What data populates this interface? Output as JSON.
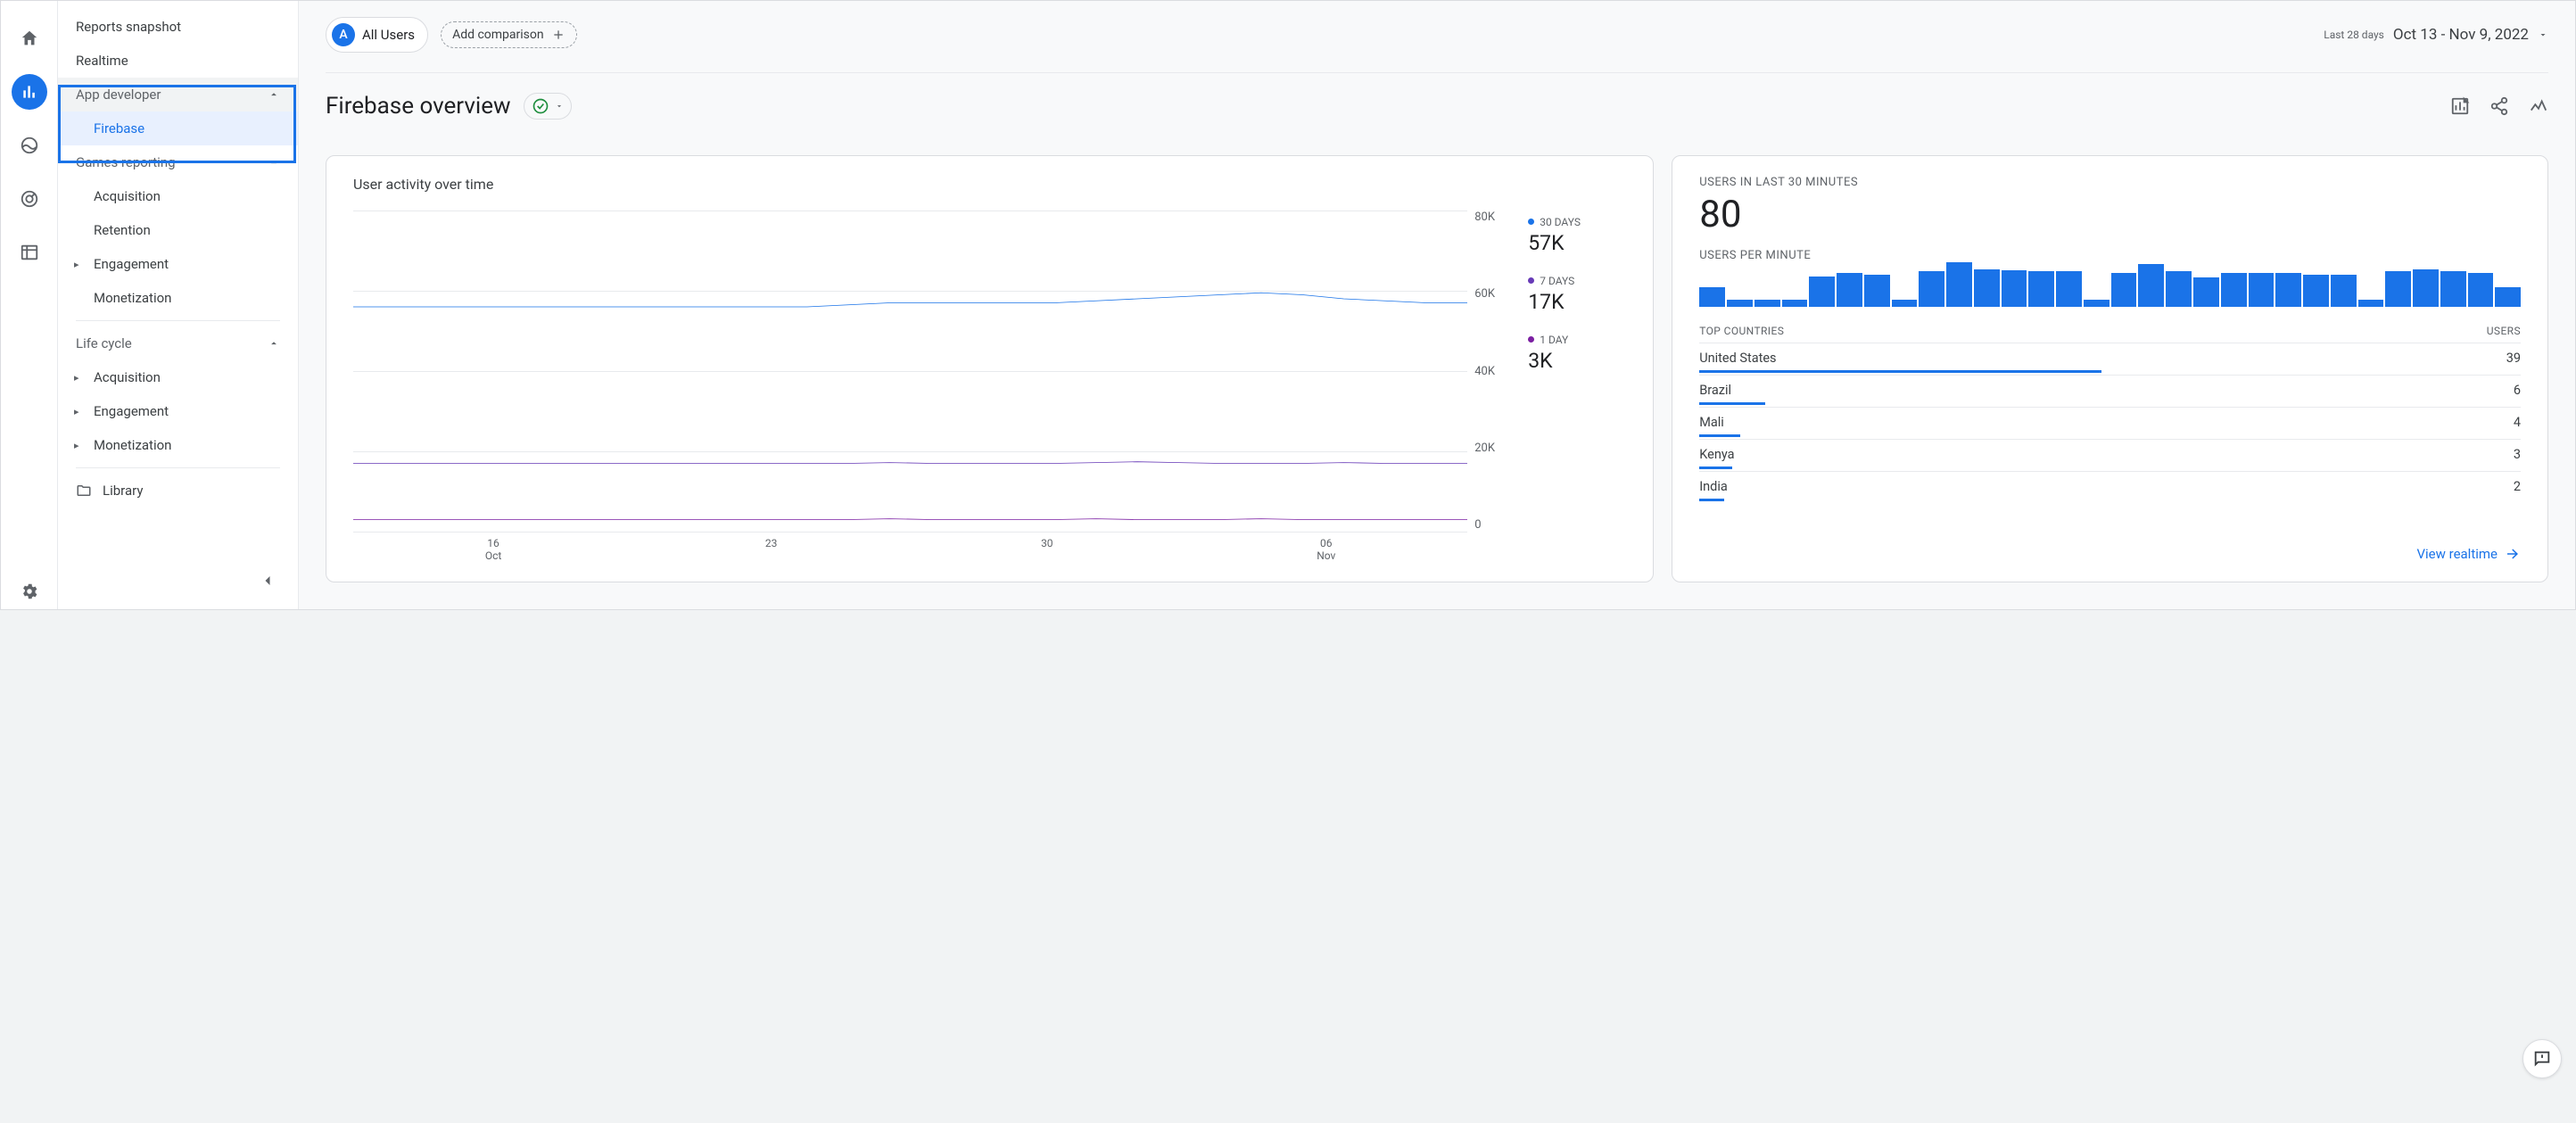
{
  "rail": {
    "active_index": 1
  },
  "sidebar": {
    "top": [
      {
        "label": "Reports snapshot"
      },
      {
        "label": "Realtime"
      }
    ],
    "groups": [
      {
        "label": "App developer",
        "items": [
          {
            "label": "Firebase",
            "selected": true
          }
        ],
        "highlighted_frame": true
      },
      {
        "label": "Games reporting",
        "items": [
          {
            "label": "Acquisition"
          },
          {
            "label": "Retention"
          },
          {
            "label": "Engagement",
            "has_children": true
          },
          {
            "label": "Monetization"
          }
        ]
      },
      {
        "label": "Life cycle",
        "items": [
          {
            "label": "Acquisition",
            "has_children": true
          },
          {
            "label": "Engagement",
            "has_children": true
          },
          {
            "label": "Monetization",
            "has_children": true
          }
        ]
      }
    ],
    "library_label": "Library"
  },
  "segments": {
    "badge_letter": "A",
    "all_users_label": "All Users",
    "add_label": "Add comparison"
  },
  "daterange": {
    "label": "Last 28 days",
    "value": "Oct 13 - Nov 9, 2022"
  },
  "page_title": "Firebase overview",
  "card_activity": {
    "title": "User activity over time",
    "legend": [
      {
        "label": "30 DAYS",
        "value": "57K",
        "color": "#1a73e8"
      },
      {
        "label": "7 DAYS",
        "value": "17K",
        "color": "#673ab7"
      },
      {
        "label": "1 DAY",
        "value": "3K",
        "color": "#7b1fa2"
      }
    ]
  },
  "card_realtime": {
    "label_users_30m": "USERS IN LAST 30 MINUTES",
    "users_30m": "80",
    "label_upm": "USERS PER MINUTE",
    "top_countries_label": "TOP COUNTRIES",
    "users_label": "USERS",
    "countries": [
      {
        "name": "United States",
        "value": "39",
        "bar": 49
      },
      {
        "name": "Brazil",
        "value": "6",
        "bar": 8
      },
      {
        "name": "Mali",
        "value": "4",
        "bar": 5
      },
      {
        "name": "Kenya",
        "value": "3",
        "bar": 4
      },
      {
        "name": "India",
        "value": "2",
        "bar": 3
      }
    ],
    "link_label": "View realtime"
  },
  "chart_data": {
    "type": "line",
    "title": "User activity over time",
    "ylabel": "",
    "ylim": [
      0,
      80000
    ],
    "y_ticks": [
      "80K",
      "60K",
      "40K",
      "20K",
      "0"
    ],
    "x_ticks": [
      {
        "top": "16",
        "bottom": "Oct"
      },
      {
        "top": "23",
        "bottom": ""
      },
      {
        "top": "30",
        "bottom": ""
      },
      {
        "top": "06",
        "bottom": "Nov"
      }
    ],
    "series": [
      {
        "name": "30 DAYS",
        "color": "#1a73e8",
        "values": [
          56000,
          56000,
          56000,
          56000,
          56000,
          56000,
          56000,
          56000,
          56000,
          56000,
          56000,
          56000,
          56500,
          57000,
          57000,
          57000,
          57000,
          57000,
          57500,
          58000,
          58500,
          59000,
          59500,
          59000,
          58000,
          57500,
          57000,
          57000
        ]
      },
      {
        "name": "7 DAYS",
        "color": "#673ab7",
        "values": [
          17000,
          17000,
          17000,
          17000,
          17000,
          17000,
          17000,
          17000,
          17000,
          17000,
          17000,
          17000,
          17000,
          17200,
          17000,
          17000,
          17000,
          17000,
          17200,
          17400,
          17200,
          17000,
          17000,
          17000,
          17200,
          17000,
          17000,
          17000
        ]
      },
      {
        "name": "1 DAY",
        "color": "#7b1fa2",
        "values": [
          3000,
          3000,
          3000,
          3000,
          3000,
          3000,
          3000,
          3000,
          3000,
          3000,
          3000,
          3000,
          3000,
          3200,
          3000,
          3000,
          3000,
          3000,
          3200,
          3000,
          3000,
          3000,
          3200,
          3000,
          3000,
          3000,
          3000,
          3000
        ]
      }
    ],
    "spark_bars": [
      22,
      8,
      8,
      8,
      34,
      38,
      36,
      8,
      40,
      50,
      42,
      41,
      40,
      40,
      8,
      38,
      48,
      40,
      33,
      38,
      38,
      38,
      36,
      36,
      8,
      40,
      42,
      40,
      38,
      22
    ]
  }
}
